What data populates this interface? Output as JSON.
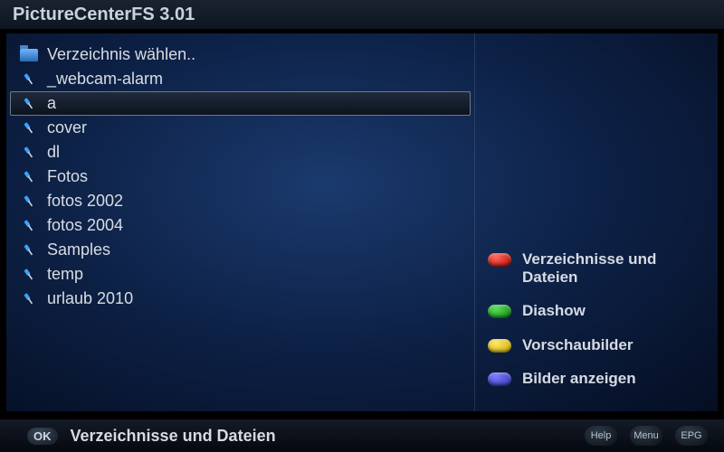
{
  "title": "PictureCenterFS  3.01",
  "list": {
    "items": [
      {
        "icon": "folder",
        "label": "Verzeichnis wählen..",
        "selected": false
      },
      {
        "icon": "pin",
        "label": "_webcam-alarm",
        "selected": false
      },
      {
        "icon": "pin",
        "label": "a",
        "selected": true
      },
      {
        "icon": "pin",
        "label": "cover",
        "selected": false
      },
      {
        "icon": "pin",
        "label": "dl",
        "selected": false
      },
      {
        "icon": "pin",
        "label": "Fotos",
        "selected": false
      },
      {
        "icon": "pin",
        "label": "fotos 2002",
        "selected": false
      },
      {
        "icon": "pin",
        "label": "fotos 2004",
        "selected": false
      },
      {
        "icon": "pin",
        "label": "Samples",
        "selected": false
      },
      {
        "icon": "pin",
        "label": "temp",
        "selected": false
      },
      {
        "icon": "pin",
        "label": "urlaub 2010",
        "selected": false
      }
    ]
  },
  "legend": {
    "red": "Verzeichnisse und Dateien",
    "green": "Diashow",
    "yellow": "Vorschaubilder",
    "blue": "Bilder anzeigen"
  },
  "footer": {
    "ok": "OK",
    "status": "Verzeichnisse und Dateien",
    "buttons": [
      "Help",
      "Menu",
      "EPG"
    ]
  }
}
